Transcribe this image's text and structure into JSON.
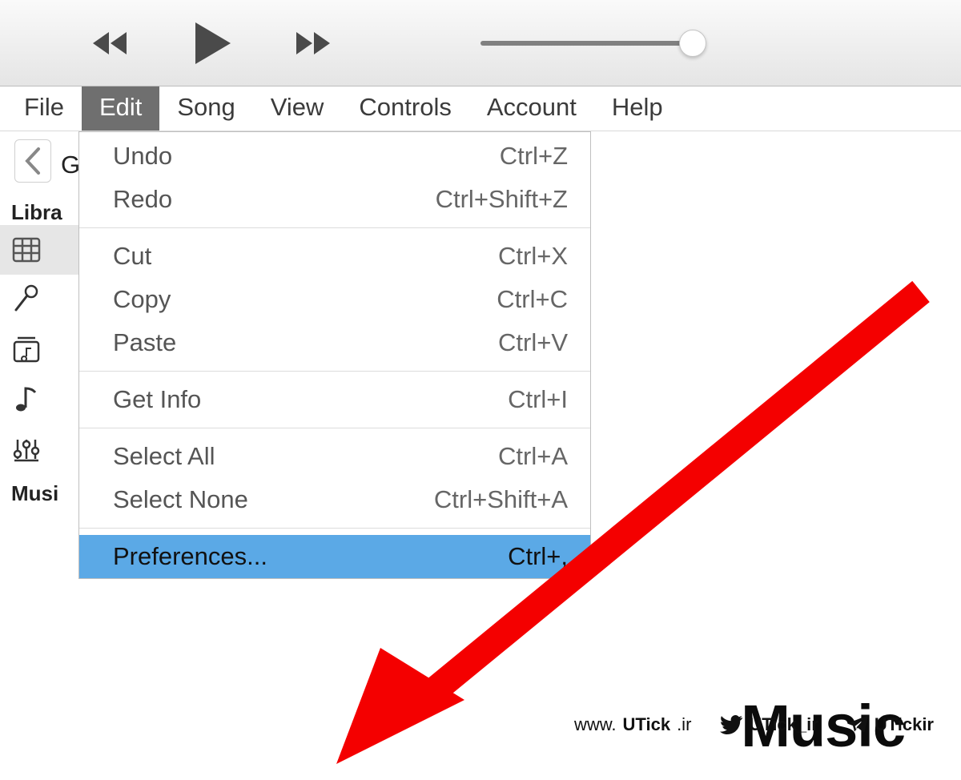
{
  "menubar": {
    "items": [
      "File",
      "Edit",
      "Song",
      "View",
      "Controls",
      "Account",
      "Help"
    ],
    "active_index": 1
  },
  "edit_menu": {
    "groups": [
      [
        {
          "label": "Undo",
          "shortcut": "Ctrl+Z"
        },
        {
          "label": "Redo",
          "shortcut": "Ctrl+Shift+Z"
        }
      ],
      [
        {
          "label": "Cut",
          "shortcut": "Ctrl+X"
        },
        {
          "label": "Copy",
          "shortcut": "Ctrl+C"
        },
        {
          "label": "Paste",
          "shortcut": "Ctrl+V"
        }
      ],
      [
        {
          "label": "Get Info",
          "shortcut": "Ctrl+I"
        }
      ],
      [
        {
          "label": "Select All",
          "shortcut": "Ctrl+A"
        },
        {
          "label": "Select None",
          "shortcut": "Ctrl+Shift+A"
        }
      ],
      [
        {
          "label": "Preferences...",
          "shortcut": "Ctrl+,",
          "highlight": true
        }
      ]
    ]
  },
  "sidebar": {
    "heading1": "Library",
    "heading1_visible": "Libra",
    "heading2": "Music Playlists",
    "heading2_visible": "Musi",
    "icons": [
      "grid-icon",
      "mic-icon",
      "box-music-icon",
      "note-icon",
      "sliders-icon"
    ],
    "genius_label": "Genius"
  },
  "annotation": {
    "big_label": "Music"
  },
  "watermark": {
    "site": "www.UTick.ir",
    "twitter": "UTick_ir",
    "telegram": "UTickir"
  }
}
